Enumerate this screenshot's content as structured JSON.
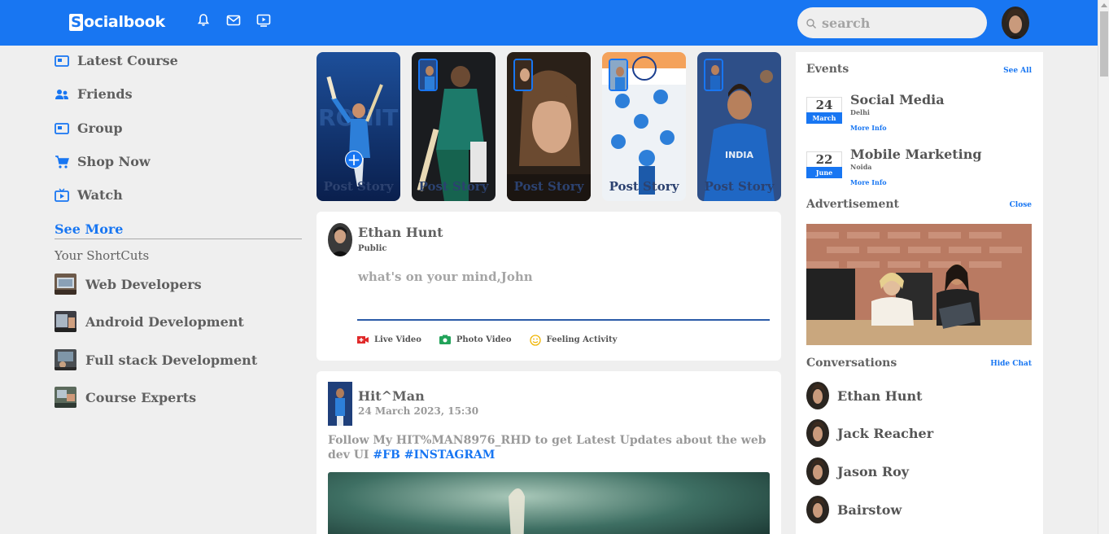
{
  "app": {
    "logo_initial": "S",
    "logo_rest": "ocialbook"
  },
  "nav": {
    "icons": [
      "bell-icon",
      "mail-icon",
      "video-icon"
    ],
    "search_placeholder": "search",
    "accent": "#1876f2"
  },
  "left": {
    "menu": [
      {
        "label": "Latest Course",
        "icon": "news-icon"
      },
      {
        "label": "Friends",
        "icon": "friends-icon"
      },
      {
        "label": "Group",
        "icon": "group-icon"
      },
      {
        "label": "Shop Now",
        "icon": "cart-icon"
      },
      {
        "label": "Watch",
        "icon": "watch-icon"
      }
    ],
    "see_more": "See More",
    "shortcuts_title": "Your ShortCuts",
    "shortcuts": [
      {
        "label": "Web Developers"
      },
      {
        "label": "Android Development"
      },
      {
        "label": "Full stack Development"
      },
      {
        "label": "Course Experts"
      }
    ]
  },
  "stories": [
    {
      "label": "Post Story",
      "plus": "+"
    },
    {
      "label": "Post Story"
    },
    {
      "label": "Post Story"
    },
    {
      "label": "Post Story"
    },
    {
      "label": "Post Story"
    }
  ],
  "write_post": {
    "name": "Ethan Hunt",
    "privacy": "Public",
    "placeholder": "what's on your mind,John",
    "actions": [
      {
        "label": "Live Video",
        "icon": "live-video-icon"
      },
      {
        "label": "Photo Video",
        "icon": "photo-icon"
      },
      {
        "label": "Feeling Activity",
        "icon": "smile-icon"
      }
    ]
  },
  "post": {
    "name": "Hit^Man",
    "date": "24 March 2023, 15:30",
    "text": "Follow My HIT%MAN8976_RHD to get Latest Updates about the web dev UI",
    "tag1": "#FB",
    "tag2": "#INSTAGRAM"
  },
  "right": {
    "events_title": "Events",
    "see_all": "See All",
    "events": [
      {
        "day": "24",
        "month": "March",
        "title": "Social Media",
        "place": "Delhi",
        "more": "More Info"
      },
      {
        "day": "22",
        "month": "June",
        "title": "Mobile Marketing",
        "place": "Noida",
        "more": "More Info"
      }
    ],
    "ad_title": "Advertisement",
    "close": "Close",
    "conv_title": "Conversations",
    "hide_chat": "Hide Chat",
    "conversations": [
      {
        "name": "Ethan Hunt"
      },
      {
        "name": "Jack Reacher"
      },
      {
        "name": "Jason Roy"
      },
      {
        "name": "Bairstow"
      }
    ]
  }
}
